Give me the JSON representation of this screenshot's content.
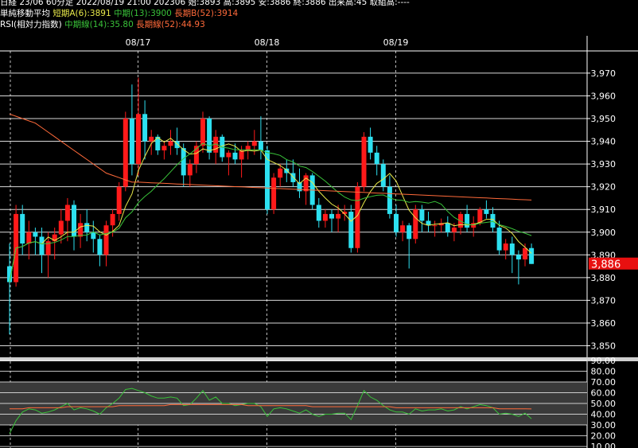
{
  "header": {
    "line1": "日経 23/06 60分足 2022/08/19 21:00 202306 始:3893 高:3895 安:3886 終:3886 出来高:45 取組高:----",
    "line2_title": "単純移動平均",
    "line2_short": "短期A(6):3891",
    "line2_mid": "中期(13):3900",
    "line2_long": "長期B(52):3914",
    "line3_title": "RSI(相対力指数)",
    "line3_mid": "中期線(14):35.80",
    "line3_long": "長期線(52):44.93"
  },
  "colors": {
    "background": "#000000",
    "up": "#ff1a1a",
    "down": "#2de0f0",
    "ma_short": "#e8e84a",
    "ma_mid": "#39c239",
    "ma_long": "#ff6a3a",
    "grid": "#ffffff",
    "last_price_bg": "#e81010"
  },
  "chart_data": [
    {
      "type": "candlestick",
      "title": "",
      "x_labels": [
        "08/17",
        "08/18",
        "08/19"
      ],
      "x_label_at_bar": [
        20,
        40,
        60
      ],
      "ylim": [
        3845,
        3980
      ],
      "yticks": [
        3850,
        3860,
        3870,
        3880,
        3890,
        3900,
        3910,
        3920,
        3930,
        3940,
        3950,
        3960,
        3970
      ],
      "last_price": "3,886",
      "candles": [
        [
          3885,
          3895,
          3855,
          3878
        ],
        [
          3878,
          3912,
          3876,
          3908
        ],
        [
          3908,
          3912,
          3890,
          3895
        ],
        [
          3895,
          3905,
          3888,
          3900
        ],
        [
          3900,
          3902,
          3890,
          3898
        ],
        [
          3898,
          3902,
          3882,
          3890
        ],
        [
          3890,
          3900,
          3880,
          3896
        ],
        [
          3896,
          3902,
          3888,
          3899
        ],
        [
          3899,
          3910,
          3895,
          3905
        ],
        [
          3905,
          3915,
          3896,
          3912
        ],
        [
          3912,
          3914,
          3892,
          3898
        ],
        [
          3898,
          3908,
          3893,
          3904
        ],
        [
          3904,
          3910,
          3896,
          3900
        ],
        [
          3900,
          3905,
          3891,
          3897
        ],
        [
          3897,
          3899,
          3885,
          3890
        ],
        [
          3890,
          3905,
          3885,
          3903
        ],
        [
          3903,
          3910,
          3898,
          3908
        ],
        [
          3908,
          3922,
          3905,
          3920
        ],
        [
          3920,
          3953,
          3918,
          3950
        ],
        [
          3950,
          3965,
          3925,
          3930
        ],
        [
          3930,
          3968,
          3925,
          3952
        ],
        [
          3952,
          3958,
          3932,
          3940
        ],
        [
          3940,
          3945,
          3934,
          3942
        ],
        [
          3942,
          3943,
          3934,
          3936
        ],
        [
          3936,
          3940,
          3932,
          3938
        ],
        [
          3938,
          3945,
          3934,
          3940
        ],
        [
          3940,
          3946,
          3934,
          3937
        ],
        [
          3937,
          3939,
          3920,
          3925
        ],
        [
          3925,
          3932,
          3920,
          3930
        ],
        [
          3930,
          3940,
          3926,
          3938
        ],
        [
          3938,
          3953,
          3935,
          3950
        ],
        [
          3950,
          3951,
          3932,
          3935
        ],
        [
          3935,
          3945,
          3930,
          3942
        ],
        [
          3942,
          3943,
          3931,
          3933
        ],
        [
          3933,
          3936,
          3925,
          3935
        ],
        [
          3935,
          3939,
          3930,
          3932
        ],
        [
          3932,
          3938,
          3924,
          3936
        ],
        [
          3936,
          3940,
          3932,
          3938
        ],
        [
          3938,
          3945,
          3934,
          3940
        ],
        [
          3940,
          3951,
          3932,
          3936
        ],
        [
          3936,
          3938,
          3908,
          3910
        ],
        [
          3910,
          3926,
          3908,
          3924
        ],
        [
          3924,
          3930,
          3920,
          3928
        ],
        [
          3928,
          3932,
          3922,
          3926
        ],
        [
          3926,
          3932,
          3920,
          3922
        ],
        [
          3922,
          3928,
          3915,
          3918
        ],
        [
          3918,
          3926,
          3912,
          3925
        ],
        [
          3925,
          3926,
          3910,
          3912
        ],
        [
          3912,
          3915,
          3902,
          3905
        ],
        [
          3905,
          3910,
          3902,
          3908
        ],
        [
          3908,
          3910,
          3900,
          3906
        ],
        [
          3906,
          3912,
          3900,
          3908
        ],
        [
          3908,
          3912,
          3905,
          3909
        ],
        [
          3909,
          3912,
          3891,
          3893
        ],
        [
          3893,
          3922,
          3891,
          3920
        ],
        [
          3920,
          3944,
          3918,
          3942
        ],
        [
          3942,
          3946,
          3932,
          3935
        ],
        [
          3935,
          3938,
          3925,
          3930
        ],
        [
          3930,
          3932,
          3918,
          3920
        ],
        [
          3920,
          3925,
          3906,
          3908
        ],
        [
          3908,
          3912,
          3898,
          3900
        ],
        [
          3900,
          3905,
          3896,
          3903
        ],
        [
          3903,
          3904,
          3884,
          3897
        ],
        [
          3897,
          3912,
          3895,
          3910
        ],
        [
          3910,
          3912,
          3900,
          3905
        ],
        [
          3905,
          3909,
          3900,
          3903
        ],
        [
          3903,
          3905,
          3898,
          3903
        ],
        [
          3903,
          3906,
          3900,
          3904
        ],
        [
          3904,
          3907,
          3898,
          3900
        ],
        [
          3900,
          3904,
          3896,
          3902
        ],
        [
          3902,
          3909,
          3899,
          3908
        ],
        [
          3908,
          3912,
          3900,
          3902
        ],
        [
          3902,
          3907,
          3898,
          3904
        ],
        [
          3904,
          3911,
          3903,
          3910
        ],
        [
          3910,
          3914,
          3906,
          3908
        ],
        [
          3908,
          3911,
          3900,
          3902
        ],
        [
          3902,
          3905,
          3890,
          3892
        ],
        [
          3892,
          3897,
          3888,
          3895
        ],
        [
          3895,
          3898,
          3882,
          3890
        ],
        [
          3890,
          3892,
          3877,
          3888
        ],
        [
          3888,
          3895,
          3885,
          3893
        ],
        [
          3893,
          3895,
          3886,
          3886
        ]
      ],
      "ma": [
        {
          "name": "短期A(6)",
          "period": 6,
          "color": "#e8e84a"
        },
        {
          "name": "中期(13)",
          "period": 13,
          "color": "#39c239"
        },
        {
          "name": "長期B(52)",
          "period": 52,
          "color": "#ff6a3a"
        }
      ],
      "ma_long_seed": [
        3952,
        3951,
        3950,
        3949,
        3948,
        3946,
        3944,
        3942,
        3940,
        3938,
        3936,
        3934,
        3932,
        3930,
        3928,
        3926,
        3925,
        3924,
        3923,
        3922
      ]
    },
    {
      "type": "line",
      "title": "",
      "ylim": [
        10,
        90
      ],
      "yticks": [
        "90.00",
        "80.00",
        "70.00",
        "60.00",
        "50.00",
        "40.00",
        "30.00",
        "20.00",
        "10.00"
      ],
      "series": [
        {
          "name": "中期線(14)",
          "color": "#39c239",
          "values": [
            22,
            34,
            42,
            45,
            44,
            41,
            42,
            44,
            47,
            50,
            44,
            46,
            45,
            43,
            40,
            46,
            50,
            55,
            63,
            64,
            62,
            60,
            57,
            55,
            55,
            56,
            55,
            48,
            49,
            55,
            62,
            53,
            56,
            50,
            50,
            48,
            49,
            50,
            50,
            47,
            38,
            45,
            46,
            45,
            43,
            41,
            44,
            40,
            38,
            40,
            40,
            41,
            41,
            35,
            48,
            62,
            56,
            53,
            48,
            44,
            42,
            42,
            40,
            45,
            43,
            44,
            44,
            45,
            43,
            44,
            47,
            45,
            47,
            49,
            48,
            46,
            40,
            41,
            40,
            38,
            41,
            35.8
          ]
        },
        {
          "name": "長期線(52)",
          "color": "#ff6a3a",
          "values": [
            45,
            45,
            45,
            46,
            46,
            46,
            46,
            46,
            46,
            47,
            47,
            47,
            47,
            47,
            47,
            47,
            47,
            48,
            48,
            48,
            48,
            48,
            48,
            48,
            48,
            49,
            49,
            49,
            49,
            49,
            49,
            49,
            49,
            49,
            49,
            49,
            49,
            48,
            48,
            48,
            48,
            48,
            48,
            48,
            48,
            48,
            48,
            47,
            47,
            47,
            47,
            47,
            47,
            47,
            47,
            47,
            47,
            47,
            47,
            47,
            46,
            46,
            46,
            46,
            46,
            46,
            46,
            46,
            46,
            46,
            46,
            46,
            46,
            46,
            46,
            46,
            45,
            45,
            45,
            45,
            45,
            44.93
          ]
        }
      ]
    }
  ]
}
